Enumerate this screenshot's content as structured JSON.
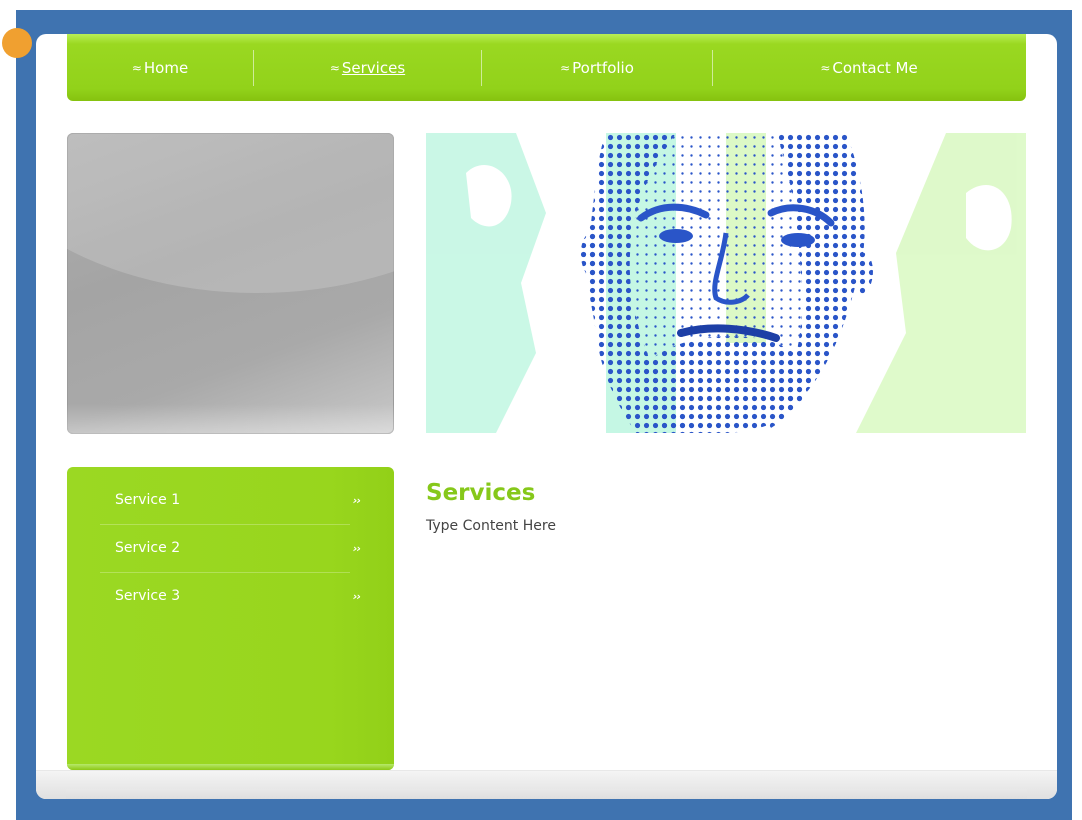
{
  "nav": {
    "items": [
      {
        "glyph": "≈",
        "label": "Home",
        "active": false
      },
      {
        "glyph": "≈",
        "label": "Services",
        "active": true
      },
      {
        "glyph": "≈",
        "label": "Portfolio",
        "active": false
      },
      {
        "glyph": "≈",
        "label": "Contact Me",
        "active": false
      }
    ]
  },
  "sidebar": {
    "items": [
      {
        "label": "Service 1",
        "arrow": "››"
      },
      {
        "label": "Service 2",
        "arrow": "››"
      },
      {
        "label": "Service 3",
        "arrow": "››"
      }
    ]
  },
  "main": {
    "heading": "Services",
    "body": "Type Content Here"
  },
  "colors": {
    "frame": "#3f73b0",
    "accent_green": "#92d21a",
    "heading_green": "#86c81a",
    "hero_blue": "#2a55c8",
    "hero_mint": "#8ff0c8"
  }
}
